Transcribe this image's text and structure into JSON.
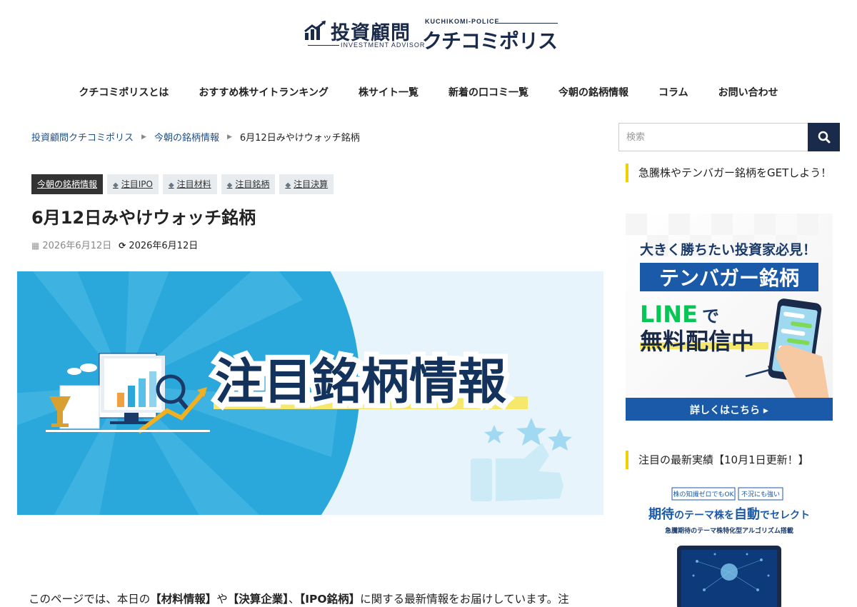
{
  "logo": {
    "main": "投資顧問",
    "sub": "INVESTMENT ADVISOR",
    "en": "KUCHIKOMI-POLICE",
    "kana": "クチコミポリス"
  },
  "nav": [
    "クチコミポリスとは",
    "おすすめ株サイトランキング",
    "株サイト一覧",
    "新着の口コミ一覧",
    "今朝の銘柄情報",
    "コラム",
    "お問い合わせ"
  ],
  "breadcrumb": {
    "home": "投資顧問クチコミポリス",
    "category": "今朝の銘柄情報",
    "current": "6月12日みやけウォッチ銘柄"
  },
  "tags": {
    "category": "今朝の銘柄情報",
    "items": [
      "注目IPO",
      "注目材料",
      "注目銘柄",
      "注目決算"
    ]
  },
  "article": {
    "title": "6月12日みやけウォッチ銘柄",
    "published": "2026年6月12日",
    "updated": "2026年6月12日",
    "hero_text": "注目銘柄情報",
    "intro": {
      "p1": "このページでは、本日の",
      "b1": "【材料情報】",
      "p2": "や",
      "b2": "【決算企業】",
      "p3": "、",
      "b3": "【IPO銘柄】",
      "p4": "に関する最新情報をお届けしています。注"
    }
  },
  "sidebar": {
    "search_placeholder": "検索",
    "widget1_title": "急騰株やテンバガー銘柄をGETしよう！",
    "banner1": {
      "line1": "大きく勝ちたい投資家必見！",
      "line2": "テンバガー銘柄",
      "line3a": "LINE",
      "line3b": "で",
      "line4": "無料配信中",
      "cta": "詳しくはこちら ▸"
    },
    "widget2_title": "注目の最新実績【10月1日更新！】",
    "banner2": {
      "badge1": "株の知識ゼロでもOK",
      "badge2": "不況にも強い",
      "head_a": "期待",
      "head_b": "のテーマ株を",
      "head_c": "自動",
      "head_d": "でセレクト",
      "sub": "急騰期待のテーマ株特化型アルゴリズム搭載"
    }
  },
  "colors": {
    "navy": "#1a2a4a",
    "link": "#1e4f8a",
    "accent_yellow": "#f0d000",
    "hero_blue": "#2aa8dc",
    "line_green": "#06c755"
  }
}
